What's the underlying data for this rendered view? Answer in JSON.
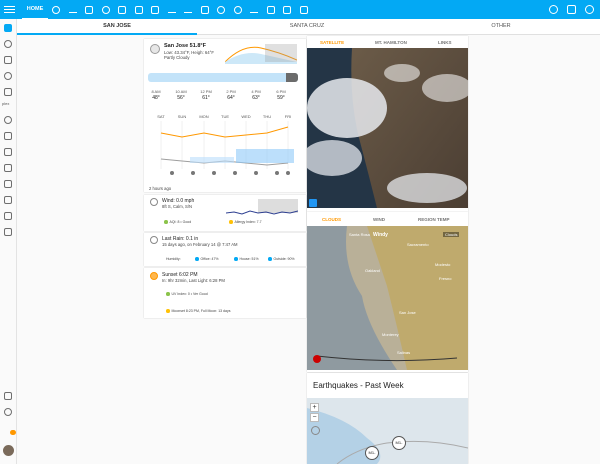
{
  "header": {
    "home_label": "HOME"
  },
  "location_tabs": [
    "SAN JOSE",
    "SANTA CRUZ",
    "OTHER"
  ],
  "weather": {
    "title": "San Jose 51.8°F",
    "low_high": "Low: 43.34°F, Heigh: 64°F",
    "condition": "Partly Cloudy",
    "hours": [
      "8 AM",
      "10 AM",
      "12 PM",
      "2 PM",
      "4 PM",
      "6 PM"
    ],
    "hour_temps": [
      "48°",
      "56°",
      "61°",
      "64°",
      "63°",
      "59°"
    ],
    "days": [
      "SAT",
      "SUN",
      "MON",
      "TUE",
      "WED",
      "THU",
      "FRI"
    ],
    "updated": "2 hours ago"
  },
  "wind": {
    "title": "Wind: 0.0 mph",
    "sub": "8ft S, Calm, S/N",
    "aqi": "AQI: 8 • Good",
    "allergy": "Allergy Index: 7.7"
  },
  "rain": {
    "title": "Last Rain: 0.1 in",
    "sub": "15 days ago, on February 14 @ 7:47 AM",
    "humidity": "Humidity:",
    "office": "Office: 47%",
    "house": "House: 51%",
    "outside": "Outside: 90%"
  },
  "sun": {
    "title": "Sunset 6:02 PM",
    "sub": "In: 9hr 32min, Last Light: 6:28 PM",
    "uv": "UV Index: 0 • Ver Good",
    "moon": "Moonset 8:23 PM, Full Moon: 13 days"
  },
  "imagery": {
    "tabs": [
      "SATELLITE",
      "MT. HAMILTON",
      "LINKS"
    ],
    "tabs2": [
      "CLOUDS",
      "WIND",
      "REGION TEMP"
    ],
    "windy": "Windy",
    "clouds": "Clouds"
  },
  "map_labels": [
    "Santa Rosa",
    "Sacramento",
    "Oakland",
    "San Jose",
    "Monterey",
    "Fresno",
    "Modesto",
    "Salinas"
  ],
  "earthquakes": {
    "title": "Earthquakes - Past Week",
    "zoom_in": "+",
    "zoom_out": "−",
    "markers": [
      "M1-",
      "M1-"
    ]
  },
  "colors": {
    "primary": "#03a9f4",
    "accent": "#ff9800"
  }
}
